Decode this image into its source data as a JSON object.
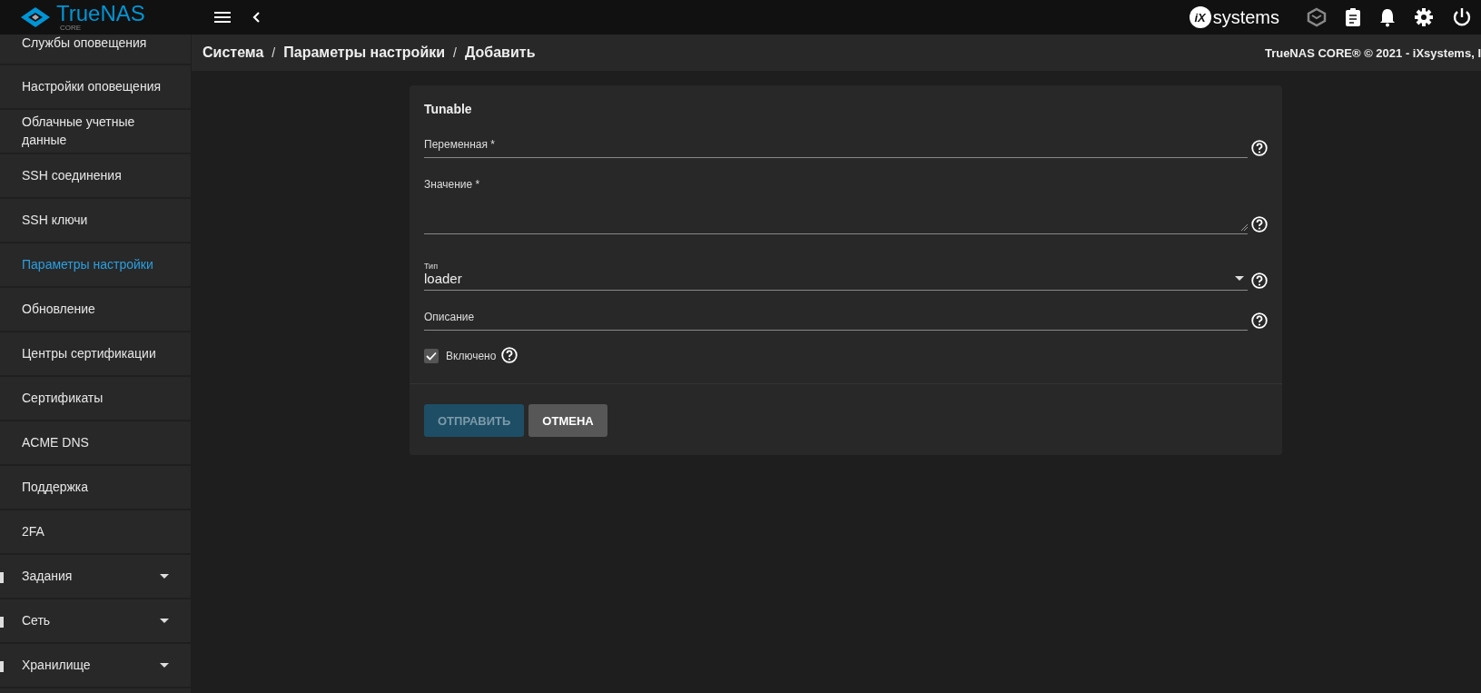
{
  "header": {
    "logo": {
      "name": "TrueNAS",
      "edition": "CORE"
    },
    "vendor": {
      "mark": "iX",
      "name": "systems"
    }
  },
  "sidebar": {
    "items": [
      {
        "kind": "item",
        "label": "Службы оповещения",
        "selected": false
      },
      {
        "kind": "item",
        "label": "Настройки оповещения",
        "selected": false
      },
      {
        "kind": "item",
        "label": "Облачные учетные данные",
        "selected": false
      },
      {
        "kind": "item",
        "label": "SSH соединения",
        "selected": false
      },
      {
        "kind": "item",
        "label": "SSH ключи",
        "selected": false
      },
      {
        "kind": "item",
        "label": "Параметры настройки",
        "selected": true
      },
      {
        "kind": "item",
        "label": "Обновление",
        "selected": false
      },
      {
        "kind": "item",
        "label": "Центры сертификации",
        "selected": false
      },
      {
        "kind": "item",
        "label": "Сертификаты",
        "selected": false
      },
      {
        "kind": "item",
        "label": "ACME DNS",
        "selected": false
      },
      {
        "kind": "item",
        "label": "Поддержка",
        "selected": false
      },
      {
        "kind": "item",
        "label": "2FA",
        "selected": false
      },
      {
        "kind": "group",
        "label": "Задания",
        "expanded": false
      },
      {
        "kind": "group",
        "label": "Сеть",
        "expanded": false
      },
      {
        "kind": "group",
        "label": "Хранилище",
        "expanded": false
      }
    ]
  },
  "breadcrumbs": {
    "items": [
      "Система",
      "Параметры настройки",
      "Добавить"
    ],
    "separator": "/"
  },
  "copyright": "TrueNAS CORE® © 2021 - iXsystems, I",
  "form": {
    "title": "Tunable",
    "fields": [
      {
        "kind": "input",
        "label": "Переменная *"
      },
      {
        "kind": "textarea",
        "label": "Значение *"
      },
      {
        "kind": "select",
        "label": "Тип",
        "value": "loader"
      },
      {
        "kind": "input",
        "label": "Описание"
      }
    ],
    "checkbox": {
      "label": "Включено",
      "checked": true
    },
    "buttons": [
      {
        "label": "ОТПРАВИТЬ",
        "disabled": true
      },
      {
        "label": "ОТМЕНА",
        "disabled": false
      }
    ]
  }
}
